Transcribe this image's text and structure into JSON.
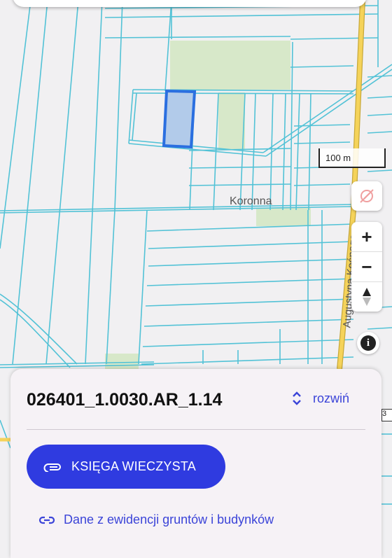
{
  "map": {
    "place_label": "Koronna",
    "road_label": "Augustyna Kośnego",
    "scale_label": "100 m",
    "edge_badge": "3",
    "colors": {
      "parcel_line": "#52c2d6",
      "selected_parcel_fill": "#b2cbea",
      "selected_parcel_border": "#2b6fe0",
      "road": "#f5d35a",
      "farmland": "#d7e8c9"
    }
  },
  "controls": {
    "compass_icon": "compass-off-icon",
    "zoom_in_label": "+",
    "zoom_out_label": "−",
    "north_icon": "north-arrow-icon",
    "info_label": "i"
  },
  "sheet": {
    "parcel_id": "026401_1.0030.AR_1.14",
    "expand_label": "rozwiń",
    "land_register_button": "KSIĘGA WIECZYSTA",
    "egib_link": "Dane z ewidencji gruntów i budynków",
    "accent_color": "#2f3be0"
  }
}
